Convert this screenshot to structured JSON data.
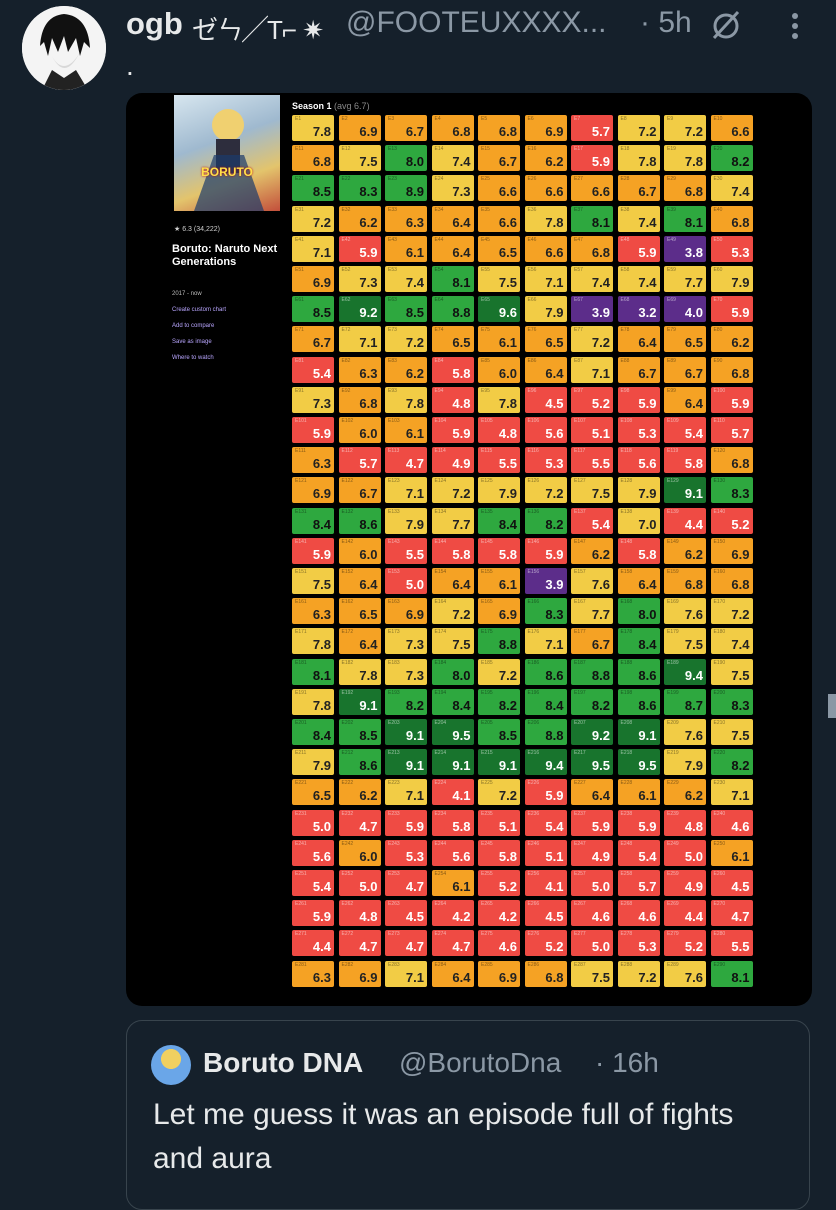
{
  "tweet": {
    "display_name": "ogb",
    "name_decoration": "ゼㄣ╱T⌐ ✷",
    "handle": "@FOOTEUXXXX...",
    "time": "· 5h",
    "text": "."
  },
  "media": {
    "show_title": "Boruto: Naruto Next Generations",
    "poster_title": "BORUTO",
    "rating": "★ 6.3 (34,222)",
    "years": "2017 - now",
    "links": [
      "Create custom chart",
      "Add to compare",
      "Save as image",
      "Where to watch"
    ],
    "season_label": "Season 1",
    "season_avg": "(avg 6.7)",
    "ratings": [
      7.8,
      6.9,
      6.7,
      6.8,
      6.8,
      6.9,
      5.7,
      7.2,
      7.2,
      6.6,
      6.8,
      7.5,
      8.0,
      7.4,
      6.7,
      6.2,
      5.9,
      7.8,
      7.8,
      8.2,
      8.5,
      8.3,
      8.9,
      7.3,
      6.6,
      6.6,
      6.6,
      6.7,
      6.8,
      7.4,
      7.2,
      6.2,
      6.3,
      6.4,
      6.6,
      7.8,
      8.1,
      7.4,
      8.1,
      6.8,
      7.1,
      5.9,
      6.1,
      6.4,
      6.5,
      6.6,
      6.8,
      5.9,
      3.8,
      5.3,
      6.9,
      7.3,
      7.4,
      8.1,
      7.5,
      7.1,
      7.4,
      7.4,
      7.7,
      7.9,
      8.5,
      9.2,
      8.5,
      8.8,
      9.6,
      7.9,
      3.9,
      3.2,
      4.0,
      5.9,
      6.7,
      7.1,
      7.2,
      6.5,
      6.1,
      6.5,
      7.2,
      6.4,
      6.5,
      6.2,
      5.4,
      6.3,
      6.2,
      5.8,
      6.0,
      6.4,
      7.1,
      6.7,
      6.7,
      6.8,
      7.3,
      6.8,
      7.8,
      4.8,
      7.8,
      4.5,
      5.2,
      5.9,
      6.4,
      5.9,
      5.9,
      6.0,
      6.1,
      5.9,
      4.8,
      5.6,
      5.1,
      5.3,
      5.4,
      5.7,
      6.3,
      5.7,
      4.7,
      4.9,
      5.5,
      5.3,
      5.5,
      5.6,
      5.8,
      6.8,
      6.9,
      6.7,
      7.1,
      7.2,
      7.9,
      7.2,
      7.5,
      7.9,
      9.1,
      8.3,
      8.4,
      8.6,
      7.9,
      7.7,
      8.4,
      8.2,
      5.4,
      7.0,
      4.4,
      5.2,
      5.9,
      6.0,
      5.5,
      5.8,
      5.8,
      5.9,
      6.2,
      5.8,
      6.2,
      6.9,
      7.5,
      6.4,
      5.0,
      6.4,
      6.1,
      3.9,
      7.6,
      6.4,
      6.8,
      6.8,
      6.3,
      6.5,
      6.9,
      7.2,
      6.9,
      8.3,
      7.7,
      8.0,
      7.6,
      7.2,
      7.8,
      6.4,
      7.3,
      7.5,
      8.8,
      7.1,
      6.7,
      8.4,
      7.5,
      7.4,
      8.1,
      7.8,
      7.3,
      8.0,
      7.2,
      8.6,
      8.8,
      8.6,
      9.4,
      7.5,
      7.8,
      9.1,
      8.2,
      8.4,
      8.2,
      8.4,
      8.2,
      8.6,
      8.7,
      8.3,
      8.4,
      8.5,
      9.1,
      9.5,
      8.5,
      8.8,
      9.2,
      9.1,
      7.6,
      7.5,
      7.9,
      8.6,
      9.1,
      9.1,
      9.1,
      9.4,
      9.5,
      9.5,
      7.9,
      8.2,
      6.5,
      6.2,
      7.1,
      4.1,
      7.2,
      5.9,
      6.4,
      6.1,
      6.2,
      7.1,
      5.0,
      4.7,
      5.9,
      5.8,
      5.1,
      5.4,
      5.9,
      5.9,
      4.8,
      4.6,
      5.6,
      6.0,
      5.3,
      5.6,
      5.8,
      5.1,
      4.9,
      5.4,
      5.0,
      6.1,
      5.4,
      5.0,
      4.7,
      6.1,
      5.2,
      4.1,
      5.0,
      5.7,
      4.9,
      4.5,
      5.9,
      4.8,
      4.5,
      4.2,
      4.2,
      4.5,
      4.6,
      4.6,
      4.4,
      4.7,
      4.4,
      4.7,
      4.7,
      4.7,
      4.6,
      5.2,
      5.0,
      5.3,
      5.2,
      5.5,
      6.3,
      6.9,
      7.1,
      6.4,
      6.9,
      6.8,
      7.5,
      7.2,
      7.6,
      8.1
    ]
  },
  "quote": {
    "display_name": "Boruto DNA",
    "handle": "@BorutoDna",
    "time": "· 16h",
    "text": "Let me guess it was an episode full of fights and aura"
  }
}
